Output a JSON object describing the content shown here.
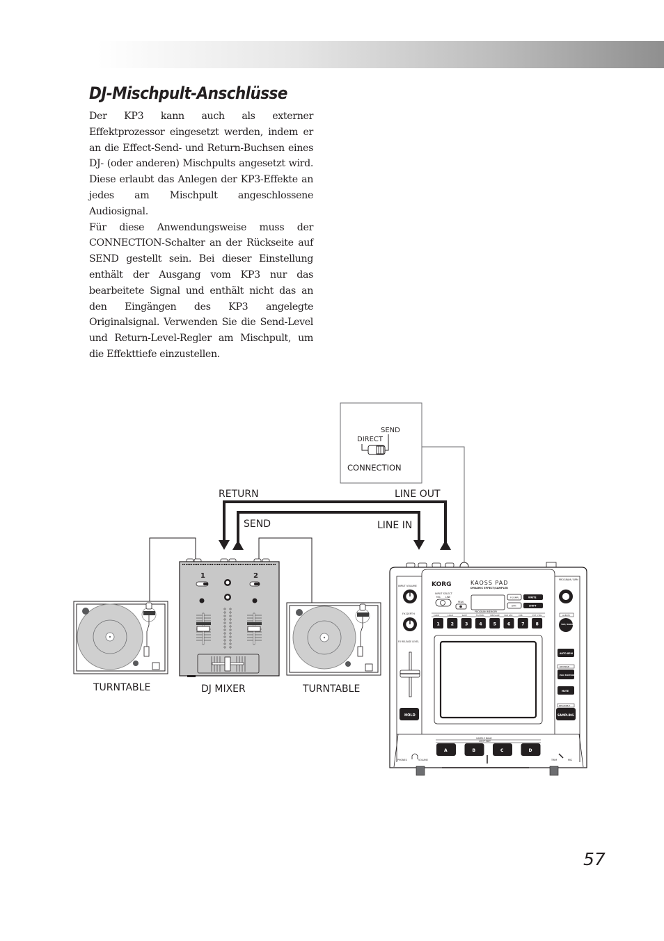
{
  "header": {
    "title": "DJ-Mischpult-Anschlüsse"
  },
  "body": {
    "paragraphs": [
      "Der KP3 kann auch als externer Effektprozessor eingesetzt werden, indem er an die Effect-Send- und Return-Buchsen eines DJ- (oder anderen) Mischpults angesetzt wird. Diese erlaubt das Anlegen der KP3-Effekte an jedes am Mischpult angeschlossene Audiosignal.",
      "Für diese Anwendungsweise muss der CONNECTION-Schalter an der Rückseite auf SEND gestellt sein. Bei dieser Einstellung enthält der Ausgang vom KP3 nur das bearbeitete Signal und enthält nicht das an den Eingängen des KP3 angelegte Originalsignal. Verwenden Sie die Send-Level und Return-Level-Regler am Mischpult, um die Effekttiefe einzustellen."
    ]
  },
  "diagram": {
    "connection_box": {
      "send_label": "SEND",
      "direct_label": "DIRECT",
      "title": "CONNECTION"
    },
    "labels": {
      "return": "RETURN",
      "send": "SEND",
      "line_out": "LINE OUT",
      "line_in": "LINE IN",
      "turntable_left": "TURNTABLE",
      "dj_mixer": "DJ MIXER",
      "turntable_right": "TURNTABLE"
    },
    "mixer": {
      "channel_1": "1",
      "channel_2": "2"
    },
    "kp3": {
      "brand": "KORG",
      "model": "KAOSS PAD",
      "subtitle": "DYNAMIC EFFECT/SAMPLER",
      "input_volume": "INPUT VOLUME",
      "fx_depth": "FX DEPTH",
      "fx_release": "FX RELEASE LEVEL",
      "input_select": "INPUT SELECT",
      "mic": "MIC",
      "line": "LINE",
      "peak": "PEAK",
      "fx_smpl": "FX/SMPL",
      "bpm": "BPM",
      "write": "WRITE",
      "shift": "SHIFT",
      "program_memory": "PROGRAM MEMORY",
      "memory_labels": [
        "CARD",
        "LOAD",
        "SAVE",
        "FX/SMPL",
        "MESSAGE",
        "PAD LED",
        "USB",
        "EXT CTRL"
      ],
      "memory_buttons": [
        "1",
        "2",
        "3",
        "4",
        "5",
        "6",
        "7",
        "8"
      ],
      "program_bpm": "PROGRAM / BPM",
      "album": "ALBUM",
      "tap_range": "TAP/ RANGE",
      "auto_bpm": "AUTO BPM",
      "reverse": "REVERSE",
      "pad_motion": "PAD MOTION",
      "mute": "MUTE",
      "resample": "RESAMPLE",
      "sampling": "SAMPLING",
      "hold": "HOLD",
      "sample_bank": "SAMPLE BANK",
      "loop_edit": "LOOP EDIT",
      "bank_buttons": [
        "A",
        "B",
        "C",
        "D"
      ],
      "phones": "PHONES",
      "volume": "VOLUME",
      "trim": "TRIM",
      "mic_in": "MIC"
    }
  },
  "footer": {
    "page_number": "57"
  }
}
